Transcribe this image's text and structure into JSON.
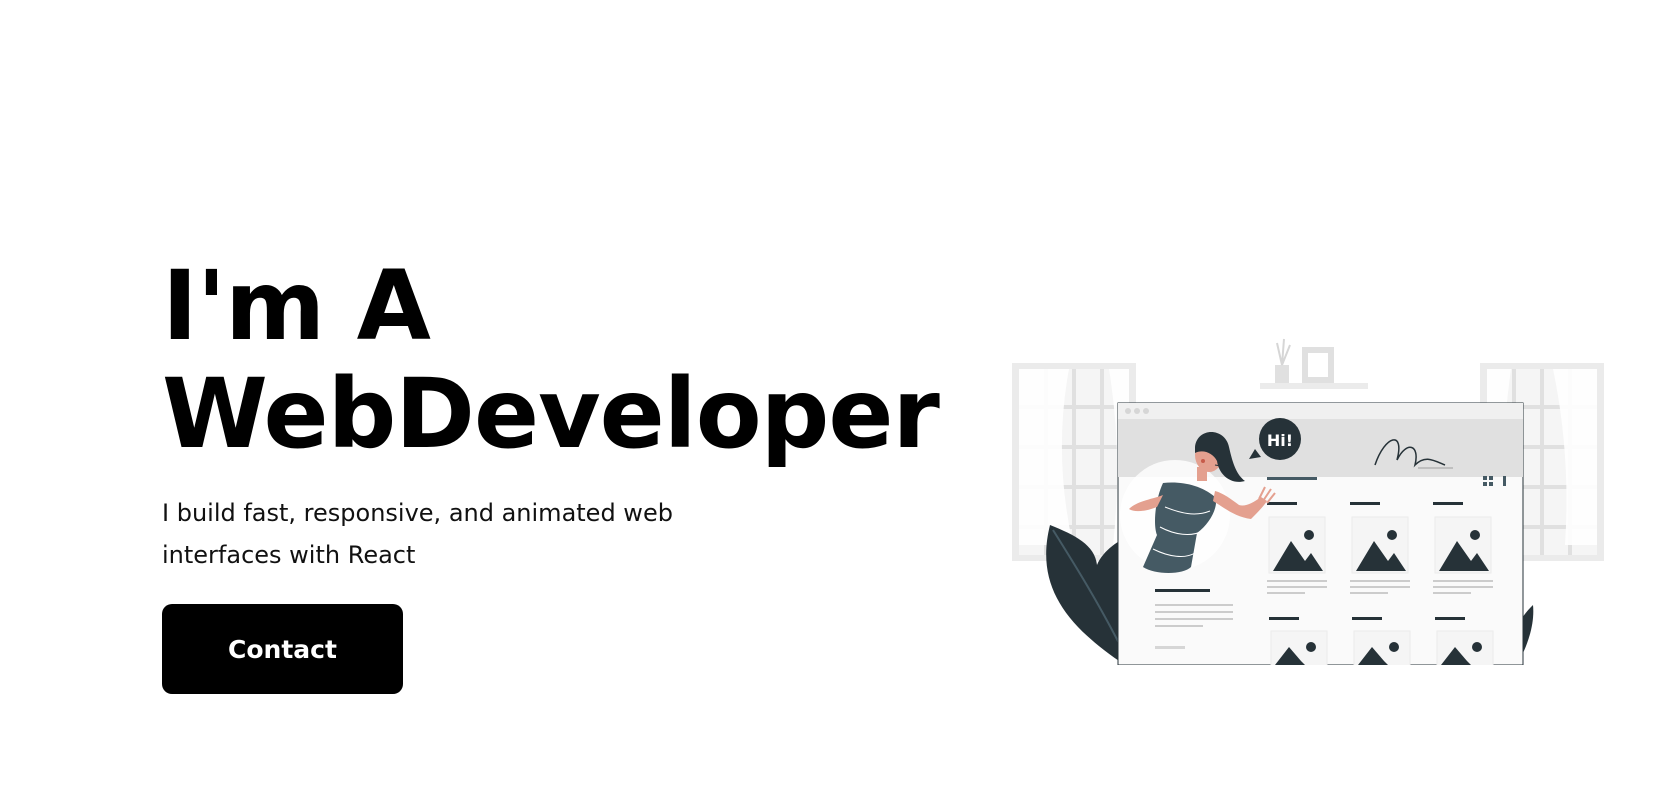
{
  "hero": {
    "title_line1": "I'm A",
    "title_line2": "WebDeveloper",
    "subtitle": "I build fast, responsive, and animated web interfaces with React",
    "contact_label": "Contact"
  },
  "illustration": {
    "speech_bubble": "Hi!"
  },
  "colors": {
    "primary": "#000000",
    "background": "#ffffff",
    "illustration_dark": "#263238",
    "illustration_light": "#e0e0e0"
  }
}
